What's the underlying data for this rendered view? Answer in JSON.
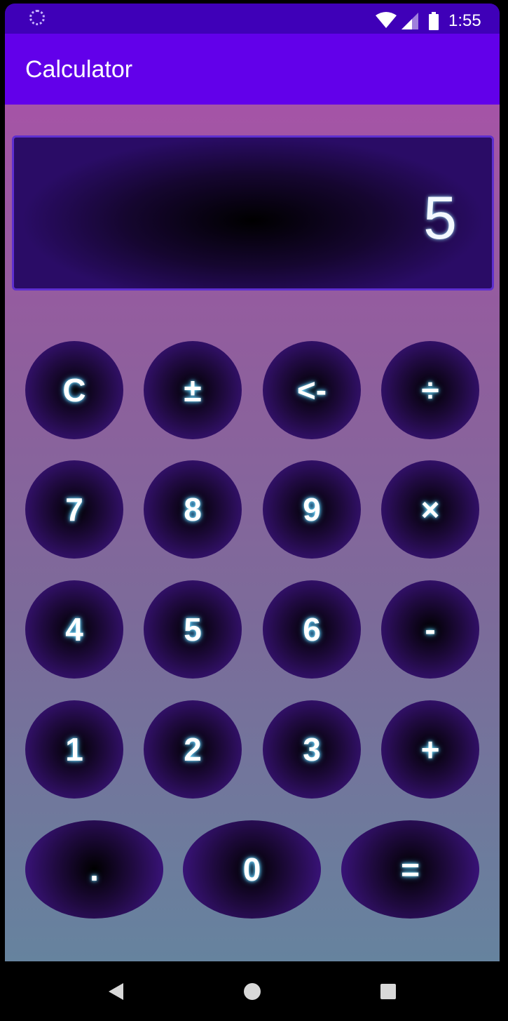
{
  "status_bar": {
    "time": "1:55"
  },
  "app_bar": {
    "title": "Calculator"
  },
  "display": {
    "value": "5"
  },
  "keypad": {
    "rows": [
      [
        "C",
        "±",
        "<-",
        "÷"
      ],
      [
        "7",
        "8",
        "9",
        "×"
      ],
      [
        "4",
        "5",
        "6",
        "-"
      ],
      [
        "1",
        "2",
        "3",
        "+"
      ],
      [
        ".",
        "0",
        "="
      ]
    ]
  },
  "colors": {
    "app_bar": "#6200ea",
    "status_bar": "#3f00b8",
    "display_border": "#5e2fcf",
    "key_glow": "#7ee6ff"
  },
  "icons": {
    "status": [
      "loading-icon",
      "wifi-icon",
      "signal-icon",
      "battery-icon"
    ],
    "nav": [
      "back-icon",
      "home-icon",
      "recents-icon"
    ]
  }
}
